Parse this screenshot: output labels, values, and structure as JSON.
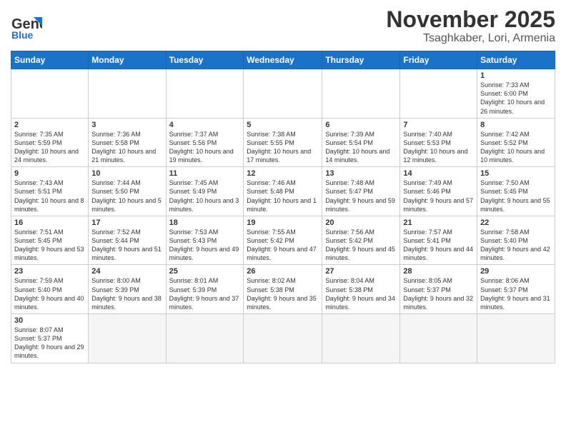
{
  "header": {
    "logo_line1": "General",
    "logo_line2": "Blue",
    "month": "November 2025",
    "location": "Tsaghkaber, Lori, Armenia"
  },
  "weekdays": [
    "Sunday",
    "Monday",
    "Tuesday",
    "Wednesday",
    "Thursday",
    "Friday",
    "Saturday"
  ],
  "weeks": [
    [
      {
        "day": "",
        "info": ""
      },
      {
        "day": "",
        "info": ""
      },
      {
        "day": "",
        "info": ""
      },
      {
        "day": "",
        "info": ""
      },
      {
        "day": "",
        "info": ""
      },
      {
        "day": "",
        "info": ""
      },
      {
        "day": "1",
        "info": "Sunrise: 7:33 AM\nSunset: 6:00 PM\nDaylight: 10 hours and 26 minutes."
      }
    ],
    [
      {
        "day": "2",
        "info": "Sunrise: 7:35 AM\nSunset: 5:59 PM\nDaylight: 10 hours and 24 minutes."
      },
      {
        "day": "3",
        "info": "Sunrise: 7:36 AM\nSunset: 5:58 PM\nDaylight: 10 hours and 21 minutes."
      },
      {
        "day": "4",
        "info": "Sunrise: 7:37 AM\nSunset: 5:56 PM\nDaylight: 10 hours and 19 minutes."
      },
      {
        "day": "5",
        "info": "Sunrise: 7:38 AM\nSunset: 5:55 PM\nDaylight: 10 hours and 17 minutes."
      },
      {
        "day": "6",
        "info": "Sunrise: 7:39 AM\nSunset: 5:54 PM\nDaylight: 10 hours and 14 minutes."
      },
      {
        "day": "7",
        "info": "Sunrise: 7:40 AM\nSunset: 5:53 PM\nDaylight: 10 hours and 12 minutes."
      },
      {
        "day": "8",
        "info": "Sunrise: 7:42 AM\nSunset: 5:52 PM\nDaylight: 10 hours and 10 minutes."
      }
    ],
    [
      {
        "day": "9",
        "info": "Sunrise: 7:43 AM\nSunset: 5:51 PM\nDaylight: 10 hours and 8 minutes."
      },
      {
        "day": "10",
        "info": "Sunrise: 7:44 AM\nSunset: 5:50 PM\nDaylight: 10 hours and 5 minutes."
      },
      {
        "day": "11",
        "info": "Sunrise: 7:45 AM\nSunset: 5:49 PM\nDaylight: 10 hours and 3 minutes."
      },
      {
        "day": "12",
        "info": "Sunrise: 7:46 AM\nSunset: 5:48 PM\nDaylight: 10 hours and 1 minute."
      },
      {
        "day": "13",
        "info": "Sunrise: 7:48 AM\nSunset: 5:47 PM\nDaylight: 9 hours and 59 minutes."
      },
      {
        "day": "14",
        "info": "Sunrise: 7:49 AM\nSunset: 5:46 PM\nDaylight: 9 hours and 57 minutes."
      },
      {
        "day": "15",
        "info": "Sunrise: 7:50 AM\nSunset: 5:45 PM\nDaylight: 9 hours and 55 minutes."
      }
    ],
    [
      {
        "day": "16",
        "info": "Sunrise: 7:51 AM\nSunset: 5:45 PM\nDaylight: 9 hours and 53 minutes."
      },
      {
        "day": "17",
        "info": "Sunrise: 7:52 AM\nSunset: 5:44 PM\nDaylight: 9 hours and 51 minutes."
      },
      {
        "day": "18",
        "info": "Sunrise: 7:53 AM\nSunset: 5:43 PM\nDaylight: 9 hours and 49 minutes."
      },
      {
        "day": "19",
        "info": "Sunrise: 7:55 AM\nSunset: 5:42 PM\nDaylight: 9 hours and 47 minutes."
      },
      {
        "day": "20",
        "info": "Sunrise: 7:56 AM\nSunset: 5:42 PM\nDaylight: 9 hours and 45 minutes."
      },
      {
        "day": "21",
        "info": "Sunrise: 7:57 AM\nSunset: 5:41 PM\nDaylight: 9 hours and 44 minutes."
      },
      {
        "day": "22",
        "info": "Sunrise: 7:58 AM\nSunset: 5:40 PM\nDaylight: 9 hours and 42 minutes."
      }
    ],
    [
      {
        "day": "23",
        "info": "Sunrise: 7:59 AM\nSunset: 5:40 PM\nDaylight: 9 hours and 40 minutes."
      },
      {
        "day": "24",
        "info": "Sunrise: 8:00 AM\nSunset: 5:39 PM\nDaylight: 9 hours and 38 minutes."
      },
      {
        "day": "25",
        "info": "Sunrise: 8:01 AM\nSunset: 5:39 PM\nDaylight: 9 hours and 37 minutes."
      },
      {
        "day": "26",
        "info": "Sunrise: 8:02 AM\nSunset: 5:38 PM\nDaylight: 9 hours and 35 minutes."
      },
      {
        "day": "27",
        "info": "Sunrise: 8:04 AM\nSunset: 5:38 PM\nDaylight: 9 hours and 34 minutes."
      },
      {
        "day": "28",
        "info": "Sunrise: 8:05 AM\nSunset: 5:37 PM\nDaylight: 9 hours and 32 minutes."
      },
      {
        "day": "29",
        "info": "Sunrise: 8:06 AM\nSunset: 5:37 PM\nDaylight: 9 hours and 31 minutes."
      }
    ],
    [
      {
        "day": "30",
        "info": "Sunrise: 8:07 AM\nSunset: 5:37 PM\nDaylight: 9 hours and 29 minutes."
      },
      {
        "day": "",
        "info": ""
      },
      {
        "day": "",
        "info": ""
      },
      {
        "day": "",
        "info": ""
      },
      {
        "day": "",
        "info": ""
      },
      {
        "day": "",
        "info": ""
      },
      {
        "day": "",
        "info": ""
      }
    ]
  ]
}
